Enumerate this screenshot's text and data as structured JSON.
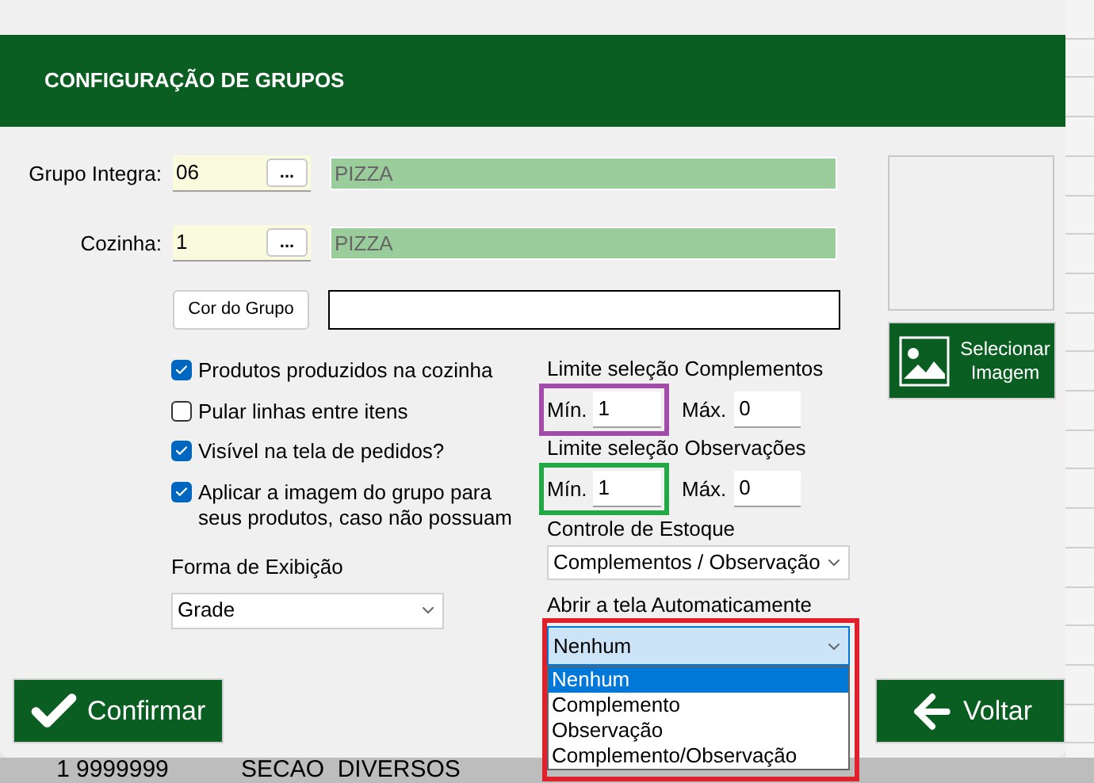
{
  "dialog": {
    "title": "CONFIGURAÇÃO DE GRUPOS",
    "grupo_integra": {
      "label": "Grupo Integra:",
      "value": "06",
      "lookup_button": "...",
      "description": "PIZZA"
    },
    "cozinha": {
      "label": "Cozinha:",
      "value": "1",
      "lookup_button": "...",
      "description": "PIZZA"
    },
    "cor_do_grupo_button": "Cor do Grupo",
    "checkboxes": [
      {
        "label": "Produtos produzidos na cozinha",
        "checked": true
      },
      {
        "label": "Pular linhas entre itens",
        "checked": false
      },
      {
        "label": "Visível na tela de pedidos?",
        "checked": true
      },
      {
        "label": "Aplicar a imagem do grupo para seus produtos, caso não possuam",
        "checked": true
      }
    ],
    "forma_exibicao": {
      "label": "Forma de Exibição",
      "value": "Grade"
    },
    "limits": [
      {
        "label": "Limite seleção Complementos",
        "min_label": "Mín.",
        "min": "1",
        "max_label": "Máx.",
        "max": "0"
      },
      {
        "label": "Limite seleção Observações",
        "min_label": "Mín.",
        "min": "1",
        "max_label": "Máx.",
        "max": "0"
      }
    ],
    "controle_estoque": {
      "label": "Controle de Estoque",
      "value": "Complementos / Observação"
    },
    "abrir_tela": {
      "label": "Abrir a tela Automaticamente",
      "value": "Nenhum",
      "expanded": true,
      "options": [
        {
          "label": "Nenhum",
          "selected": true
        },
        {
          "label": "Complemento",
          "selected": false
        },
        {
          "label": "Observação",
          "selected": false
        },
        {
          "label": "Complemento/Observação",
          "selected": false
        }
      ]
    },
    "select_image_button": "Selecionar Imagem",
    "confirm_button": "Confirmar",
    "back_button": "Voltar"
  },
  "background_table": {
    "row": [
      "1",
      "9999999",
      "SECAO  DIVERSOS"
    ]
  }
}
